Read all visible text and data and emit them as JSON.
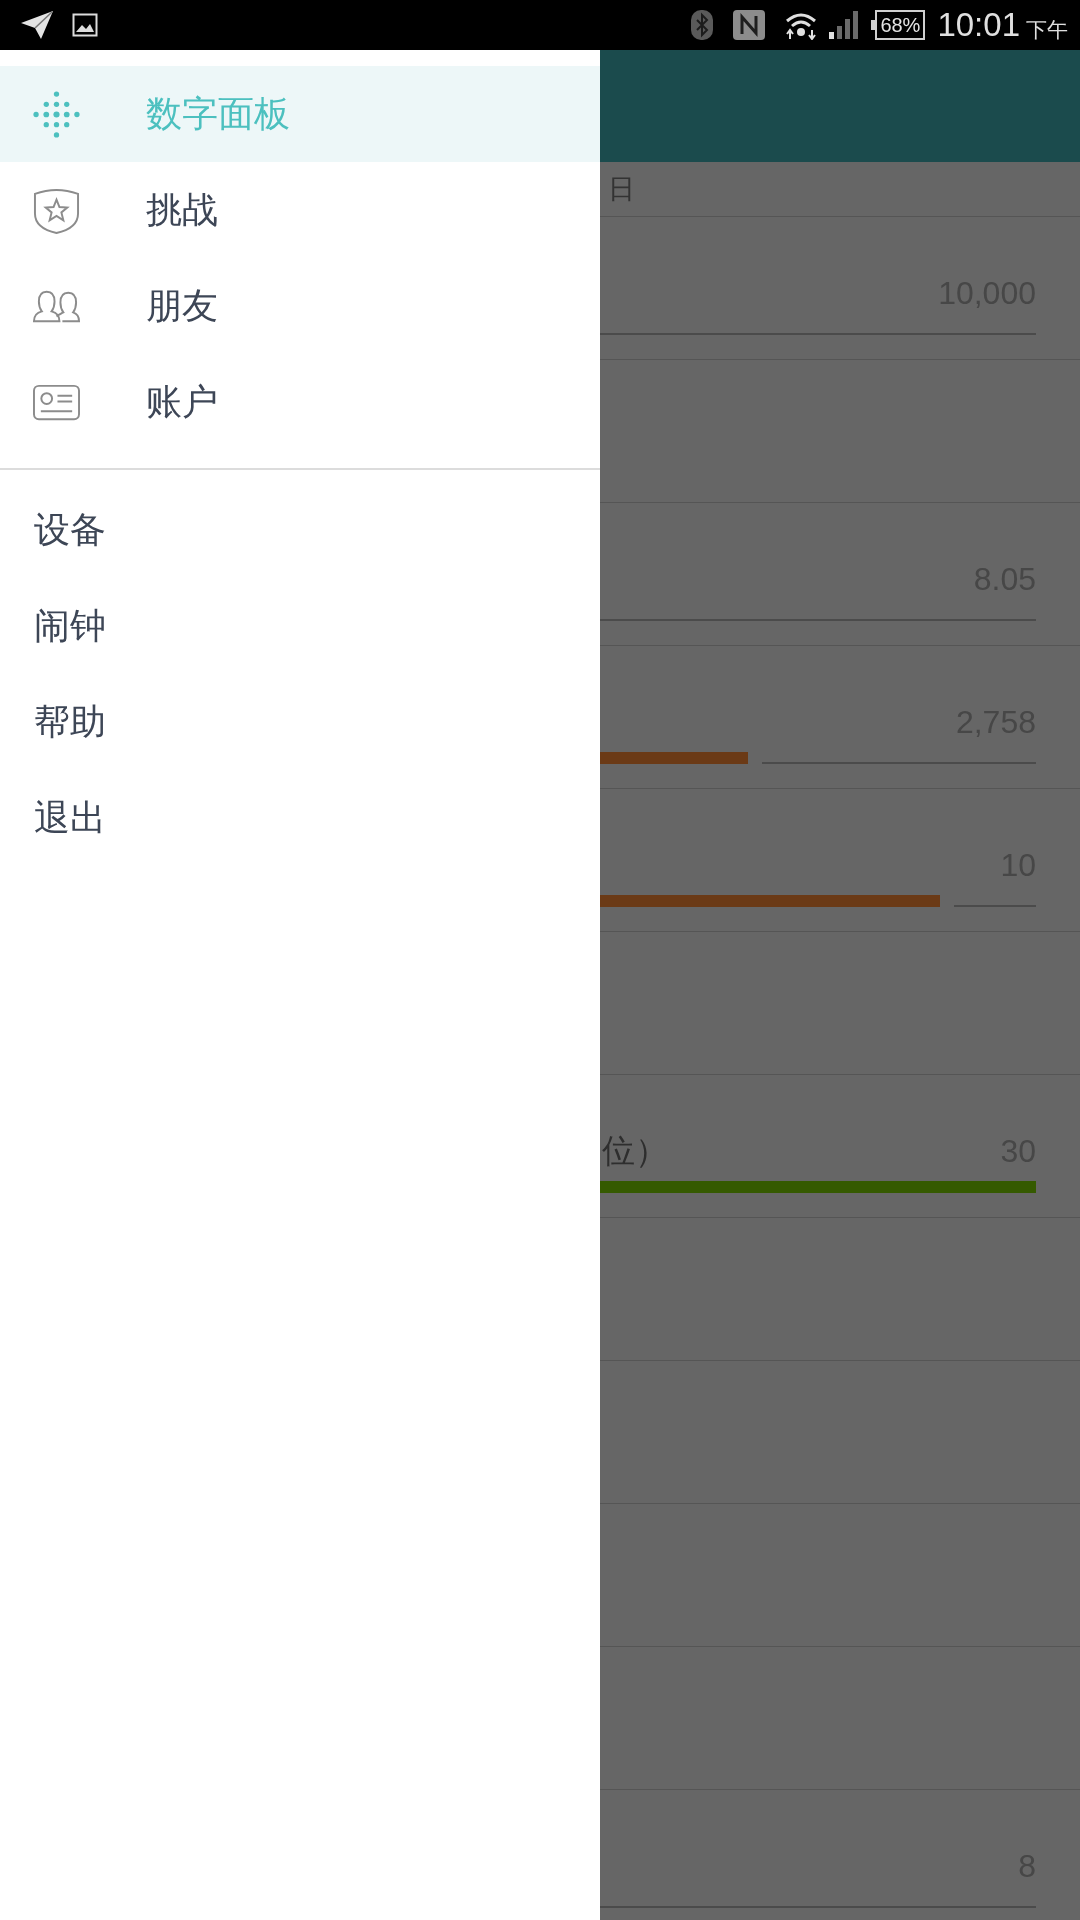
{
  "status_bar": {
    "battery": "68%",
    "time": "10:01",
    "period": "下午"
  },
  "drawer": {
    "primary": [
      {
        "label": "数字面板",
        "selected": true
      },
      {
        "label": "挑战",
        "selected": false
      },
      {
        "label": "朋友",
        "selected": false
      },
      {
        "label": "账户",
        "selected": false
      }
    ],
    "secondary": [
      {
        "label": "设备",
        "selected": false
      },
      {
        "label": "闹钟",
        "selected": false
      },
      {
        "label": "帮助",
        "selected": false
      },
      {
        "label": "退出",
        "selected": false
      }
    ]
  },
  "background": {
    "date_label": "日",
    "rows": [
      {
        "kind": "value",
        "value": "10,000"
      },
      {
        "kind": "blank"
      },
      {
        "kind": "value",
        "value": "8.05"
      },
      {
        "kind": "meter",
        "value": "2,758",
        "level": 0.34,
        "color": "#6b3a16"
      },
      {
        "kind": "meter",
        "value": "10",
        "level": 0.78,
        "color": "#6b3a16"
      },
      {
        "kind": "blank"
      },
      {
        "kind": "meter",
        "label": "位）",
        "value": "30",
        "level": 1,
        "color": "#355a00"
      },
      {
        "kind": "blank"
      },
      {
        "kind": "blank"
      },
      {
        "kind": "blank"
      },
      {
        "kind": "blank"
      },
      {
        "kind": "value",
        "value": "8"
      }
    ]
  }
}
